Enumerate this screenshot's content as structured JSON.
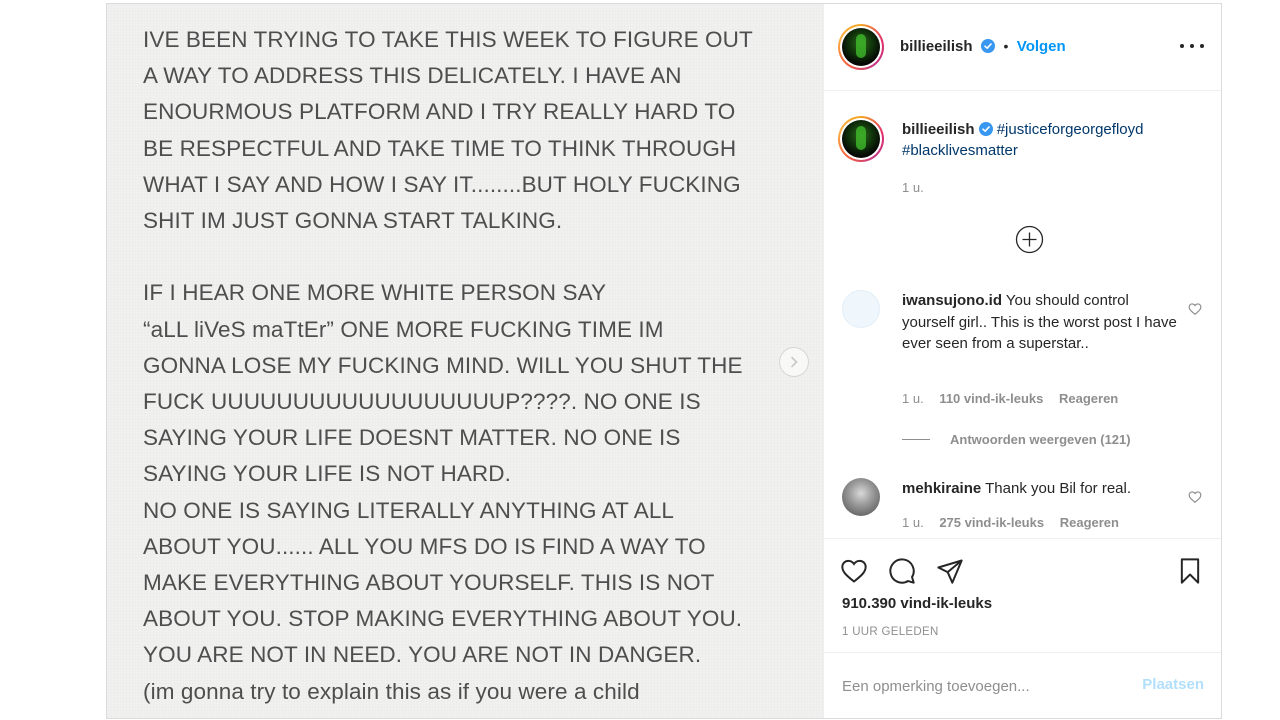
{
  "post": {
    "note_text": "IVE BEEN TRYING TO TAKE THIS WEEK TO FIGURE OUT\nA WAY TO ADDRESS THIS DELICATELY. I HAVE AN\nENOURMOUS PLATFORM AND I TRY REALLY HARD TO\nBE RESPECTFUL AND TAKE TIME TO THINK THROUGH\nWHAT I SAY AND HOW I SAY IT........BUT HOLY FUCKING\nSHIT IM JUST GONNA START TALKING.\n\nIF I HEAR ONE MORE WHITE PERSON SAY\n“aLL liVeS maTtEr” ONE MORE FUCKING TIME IM\nGONNA LOSE MY FUCKING MIND. WILL YOU SHUT THE\nFUCK UUUUUUUUUUUUUUUUUUP????. NO ONE IS\nSAYING YOUR LIFE DOESNT MATTER. NO ONE IS\nSAYING YOUR LIFE IS NOT HARD.\nNO ONE IS SAYING LITERALLY ANYTHING AT ALL\nABOUT YOU...... ALL YOU MFS DO IS FIND A WAY TO\nMAKE EVERYTHING ABOUT YOURSELF. THIS IS NOT\nABOUT YOU. STOP MAKING EVERYTHING ABOUT YOU.\nYOU ARE NOT IN NEED. YOU ARE NOT IN DANGER.\n(im gonna try to explain this as if you were a child\nbecause it FEELS LIKE THATS THE ONLY WAY YOU MFS"
  },
  "header": {
    "username": "billieeilish",
    "separator": "•",
    "follow_label": "Volgen"
  },
  "caption": {
    "username": "billieeilish",
    "hashtag1": "#justiceforgeorgefloyd",
    "hashtag2": "#blacklivesmatter",
    "time": "1 u."
  },
  "comments": [
    {
      "username": "iwansujono.id",
      "text": "You should control yourself girl.. This is the worst post I have ever seen from a superstar..",
      "time": "1 u.",
      "likes": "110 vind-ik-leuks",
      "reply_label": "Reageren",
      "view_replies": "Antwoorden weergeven (121)"
    },
    {
      "username": "mehkiraine",
      "text": "Thank you Bil for real.",
      "time": "1 u.",
      "likes": "275 vind-ik-leuks",
      "reply_label": "Reageren"
    }
  ],
  "actions": {
    "likes_count": "910.390 vind-ik-leuks",
    "posted_time": "1 UUR GELEDEN"
  },
  "add_comment": {
    "placeholder": "Een opmerking toevoegen...",
    "post_label": "Plaatsen"
  },
  "colors": {
    "link_blue": "#0095f6",
    "hashtag": "#00376b",
    "muted": "#8e8e8e",
    "text": "#262626"
  }
}
